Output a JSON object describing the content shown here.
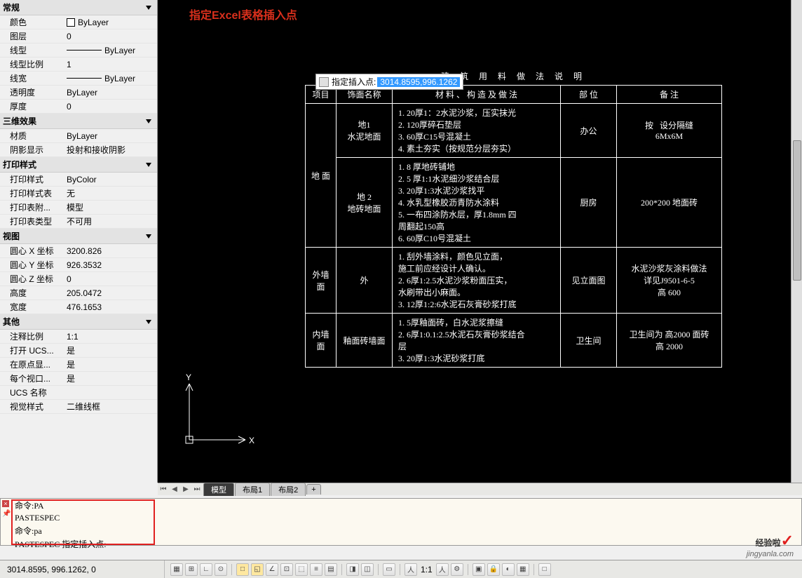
{
  "panel": {
    "general": {
      "title": "常规",
      "props": [
        {
          "label": "颜色",
          "value": "ByLayer"
        },
        {
          "label": "图层",
          "value": "0"
        },
        {
          "label": "线型",
          "value": "ByLayer"
        },
        {
          "label": "线型比例",
          "value": "1"
        },
        {
          "label": "线宽",
          "value": "ByLayer"
        },
        {
          "label": "透明度",
          "value": "ByLayer"
        },
        {
          "label": "厚度",
          "value": "0"
        }
      ]
    },
    "effect3d": {
      "title": "三维效果",
      "props": [
        {
          "label": "材质",
          "value": "ByLayer"
        },
        {
          "label": "阴影显示",
          "value": "投射和接收阴影"
        }
      ]
    },
    "print": {
      "title": "打印样式",
      "props": [
        {
          "label": "打印样式",
          "value": "ByColor"
        },
        {
          "label": "打印样式表",
          "value": "无"
        },
        {
          "label": "打印表附...",
          "value": "模型"
        },
        {
          "label": "打印表类型",
          "value": "不可用"
        }
      ]
    },
    "view": {
      "title": "视图",
      "props": [
        {
          "label": "圆心 X 坐标",
          "value": "3200.826"
        },
        {
          "label": "圆心 Y 坐标",
          "value": "926.3532"
        },
        {
          "label": "圆心 Z 坐标",
          "value": "0"
        },
        {
          "label": "高度",
          "value": "205.0472"
        },
        {
          "label": "宽度",
          "value": "476.1653"
        }
      ]
    },
    "other": {
      "title": "其他",
      "props": [
        {
          "label": "注释比例",
          "value": "1:1"
        },
        {
          "label": "打开 UCS...",
          "value": "是"
        },
        {
          "label": "在原点显...",
          "value": "是"
        },
        {
          "label": "每个视口...",
          "value": "是"
        },
        {
          "label": "UCS 名称",
          "value": ""
        },
        {
          "label": "视觉样式",
          "value": "二维线框"
        }
      ]
    }
  },
  "canvas": {
    "red_annotation": "指定Excel表格插入点",
    "insert_prompt": "指定插入点:",
    "insert_value": "3014.8595,996.1262",
    "table_title": "建 筑 用 料 做 法 说 明",
    "headers": {
      "c1": "项目",
      "c2": "饰面名称",
      "c3": "材 料 、 构 造 及 做 法",
      "c4": "部   位",
      "c5": "备   注"
    },
    "rows": [
      {
        "cat": "地 面",
        "catspan": true,
        "name": "地1\n水泥地面",
        "method": "1. 20厚1：2水泥沙浆，压实抹光\n2. 120厚碎石垫层\n3. 60厚C15号混凝土\n4. 素土夯实（按规范分层夯实）",
        "pos": "办公",
        "note": "按   设分隔缝\n6Mx6M"
      },
      {
        "name": "地 2\n地砖地面",
        "method": "1. 8 厚地砖铺地\n2. 5 厚1:1水泥细沙浆结合层\n3. 20厚1:3水泥沙浆找平\n4. 水乳型橡胶沥青防水涂料\n5. 一布四涂防水层，厚1.8mm 四\n周翻起150高\n6. 60厚C10号混凝土",
        "pos": "厨房",
        "note": "200*200 地面砖"
      },
      {
        "cat": "外墙\n面",
        "name": "外",
        "method": "1. 刮外墙涂料，颜色见立面，\n施工前应经设计人确认。\n2. 6厚1:2.5水泥沙浆粉面压实，\n水刷带出小麻面。\n3. 12厚1:2:6水泥石灰膏砂浆打底",
        "pos": "见立面图",
        "note": "水泥沙浆灰涂料做法\n详见J9501-6-5\n高 600"
      },
      {
        "cat": "内墙\n面",
        "name": "釉面砖墙面",
        "method": "1. 5厚釉面砖，白水泥浆擦缝\n2. 6厚1:0.1:2.5水泥石灰膏砂浆结合\n层\n3. 20厚1:3水泥砂浆打底",
        "pos": "卫生间",
        "note": "卫生间为 高2000 面砖\n高 2000"
      }
    ]
  },
  "tabs": {
    "items": [
      "模型",
      "布局1",
      "布局2"
    ],
    "plus": "+"
  },
  "cmd": {
    "lines": [
      "命令:PA",
      "PASTESPEC",
      "命令:pa",
      "PASTESPEC 指定插入点:"
    ]
  },
  "status": {
    "coords": "3014.8595, 996.1262, 0",
    "scale": "1:1"
  },
  "watermark": {
    "title": "经验啦",
    "check": "✓",
    "url": "jingyanla.com"
  },
  "icons": {
    "x": "X",
    "y": "Y"
  }
}
